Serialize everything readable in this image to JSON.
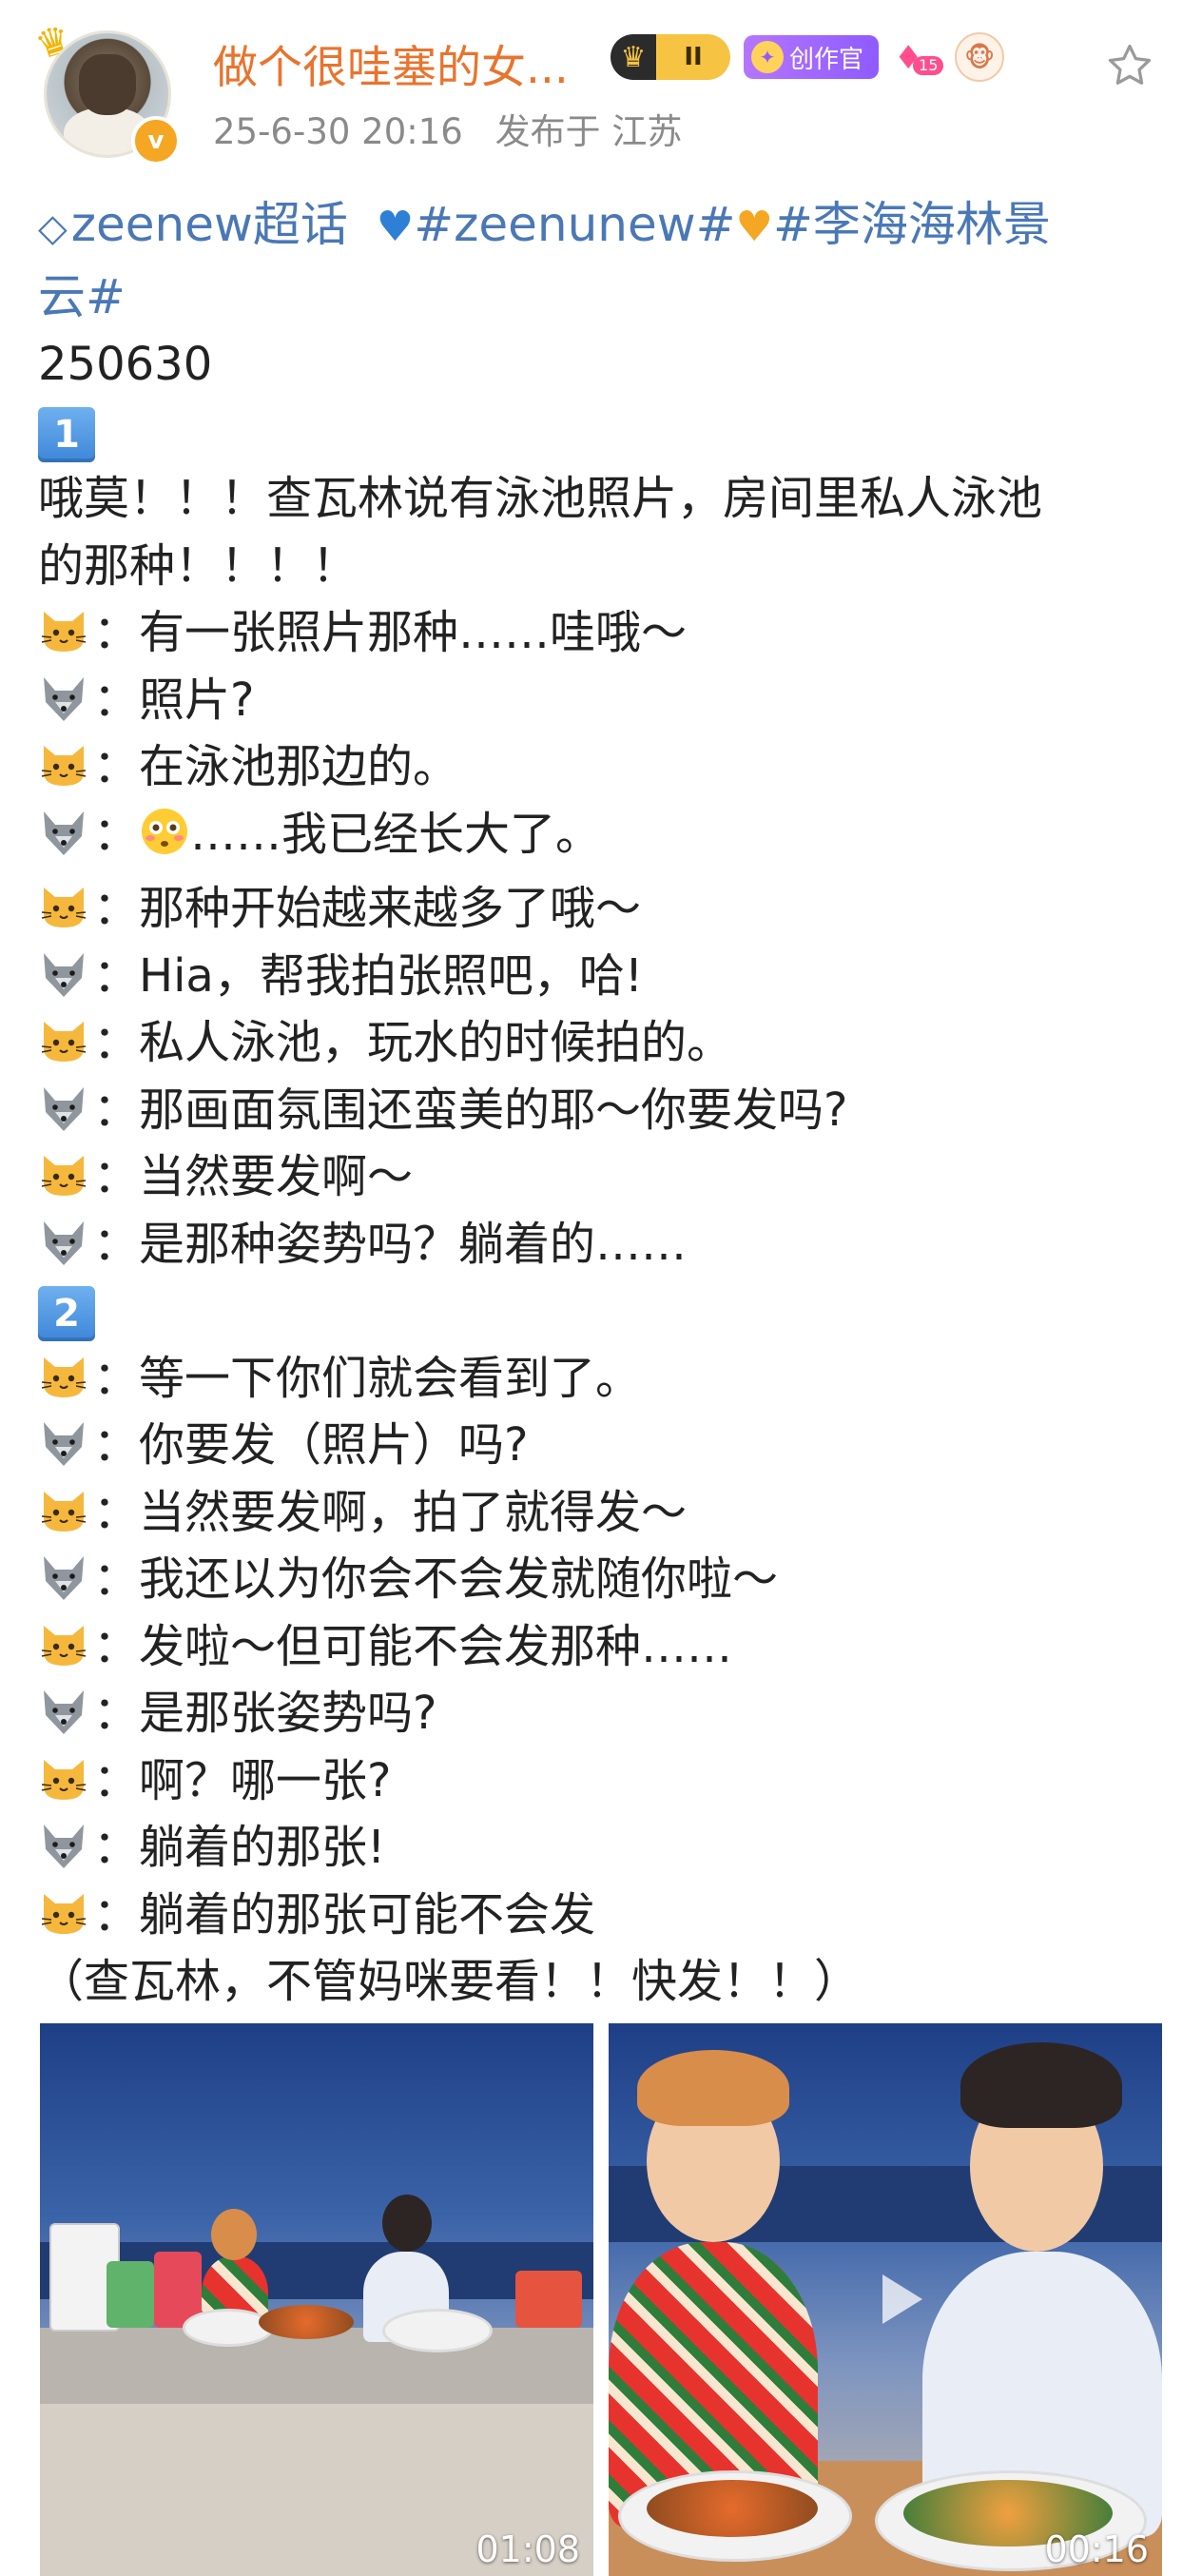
{
  "header": {
    "username": "做个很哇塞的女...",
    "rank_badge": "II",
    "creator_badge": "创作官",
    "gem_level": "15",
    "timestamp": "25-6-30 20:16",
    "location": "发布于 江苏"
  },
  "post": {
    "topic_chaohua": "zeenew超话",
    "hashtag_1": "#zeenunew#",
    "hashtag_2_part1": "#李海海林景",
    "hashtag_2_part2": "云#",
    "date_line": "250630",
    "section_1": "1",
    "intro_line1": "哦莫！！！查瓦林说有泳池照片，房间里私人泳池",
    "intro_line2": "的那种！！！！",
    "dialogue_1": [
      {
        "speaker": "cat",
        "text": "：有一张照片那种……哇哦～"
      },
      {
        "speaker": "wolf",
        "text": "：照片?"
      },
      {
        "speaker": "cat",
        "text": "：在泳池那边的。"
      },
      {
        "speaker": "wolf",
        "text": "：……我已经长大了。",
        "emoji": "flushed-face"
      },
      {
        "speaker": "cat",
        "text": "：那种开始越来越多了哦～"
      },
      {
        "speaker": "wolf",
        "text": "：Hia，帮我拍张照吧，哈!"
      },
      {
        "speaker": "cat",
        "text": "：私人泳池，玩水的时候拍的。"
      },
      {
        "speaker": "wolf",
        "text": "：那画面氛围还蛮美的耶～你要发吗?"
      },
      {
        "speaker": "cat",
        "text": "：当然要发啊～"
      },
      {
        "speaker": "wolf",
        "text": "：是那种姿势吗？躺着的……"
      }
    ],
    "section_2": "2",
    "dialogue_2": [
      {
        "speaker": "cat",
        "text": "：等一下你们就会看到了。"
      },
      {
        "speaker": "wolf",
        "text": "：你要发（照片）吗?"
      },
      {
        "speaker": "cat",
        "text": "：当然要发啊，拍了就得发～"
      },
      {
        "speaker": "wolf",
        "text": "：我还以为你会不会发就随你啦～"
      },
      {
        "speaker": "cat",
        "text": "：发啦～但可能不会发那种……"
      },
      {
        "speaker": "wolf",
        "text": "：是那张姿势吗?"
      },
      {
        "speaker": "cat",
        "text": "：啊？哪一张?"
      },
      {
        "speaker": "wolf",
        "text": "：躺着的那张!"
      },
      {
        "speaker": "cat",
        "text": "：躺着的那张可能不会发"
      }
    ],
    "closing": "（查瓦林，不管妈咪要看！！快发！！）"
  },
  "videos": [
    {
      "duration": "01:08"
    },
    {
      "duration": "00:16"
    }
  ],
  "colors": {
    "username": "#e8742d",
    "link": "#4a78b5",
    "meta": "#8a8a8a",
    "vip_badge": "#f5a623"
  },
  "icons": {
    "speaker_cat": "cat-face-icon",
    "speaker_wolf": "wolf-face-icon",
    "favorite": "star-outline-icon",
    "verified": "verified-v-icon"
  }
}
